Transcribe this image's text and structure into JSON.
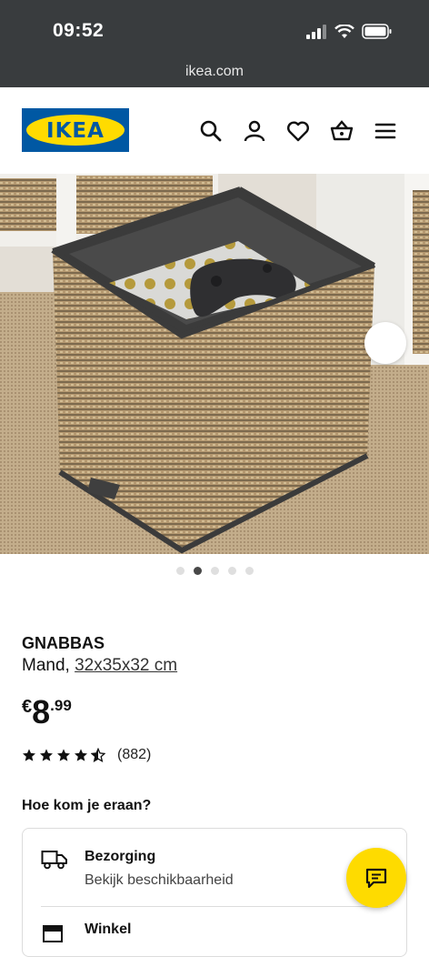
{
  "status_bar": {
    "time": "09:52"
  },
  "browser": {
    "url": "ikea.com"
  },
  "header": {
    "logo": "IKEA",
    "icons": [
      "search-icon",
      "account-icon",
      "heart-icon",
      "basket-icon",
      "menu-icon"
    ]
  },
  "gallery": {
    "slide_count": 5,
    "active_index": 1
  },
  "product": {
    "name": "GNABBAS",
    "type_label": "Mand,",
    "size": "32x35x32 cm",
    "price": {
      "currency": "€",
      "integer": "8",
      "decimal": ".99"
    },
    "rating": {
      "stars": 4.5,
      "count_label": "(882)"
    }
  },
  "availability": {
    "heading": "Hoe kom je eraan?",
    "delivery": {
      "title": "Bezorging",
      "subtitle": "Bekijk beschikbaarheid"
    },
    "store": {
      "title": "Winkel"
    }
  },
  "colors": {
    "brand_blue": "#0058a3",
    "brand_yellow": "#ffdb00",
    "status_bar": "#393c3e"
  }
}
